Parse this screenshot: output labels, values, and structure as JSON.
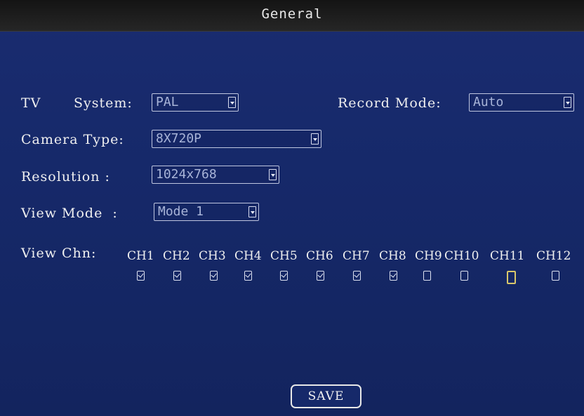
{
  "window": {
    "title": "General"
  },
  "form": {
    "tv_system": {
      "label_left": "TV",
      "label_right": "System:",
      "value": "PAL"
    },
    "record_mode": {
      "label": "Record Mode:",
      "value": "Auto"
    },
    "camera_type": {
      "label": "Camera Type:",
      "value": "8X720P"
    },
    "resolution": {
      "label": "Resolution :",
      "value": "1024x768"
    },
    "view_mode": {
      "label": "View Mode  :",
      "value": "Mode 1"
    }
  },
  "channels": {
    "label": "View Chn:",
    "items": [
      {
        "label": "CH1",
        "checked": true
      },
      {
        "label": "CH2",
        "checked": true
      },
      {
        "label": "CH3",
        "checked": true
      },
      {
        "label": "CH4",
        "checked": true
      },
      {
        "label": "CH5",
        "checked": true
      },
      {
        "label": "CH6",
        "checked": true
      },
      {
        "label": "CH7",
        "checked": true
      },
      {
        "label": "CH8",
        "checked": true
      },
      {
        "label": "CH9",
        "checked": false
      },
      {
        "label": "CH10",
        "checked": false
      },
      {
        "label": "CH11",
        "checked": false,
        "focused": true
      },
      {
        "label": "CH12",
        "checked": false
      }
    ]
  },
  "actions": {
    "save_label": "SAVE"
  },
  "colors": {
    "background": "#16296a",
    "titlebar": "#1e1e1e",
    "focus": "#d9c76a"
  }
}
